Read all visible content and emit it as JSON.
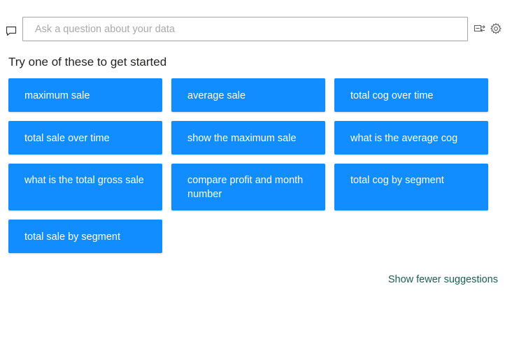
{
  "qa": {
    "search": {
      "placeholder": "Ask a question about your data",
      "value": ""
    },
    "heading": "Try one of these to get started",
    "suggestions": [
      "maximum sale",
      "average sale",
      "total cog over time",
      "total sale over time",
      "show the maximum sale",
      "what is the average cog",
      "what is the total gross sale",
      "compare profit and month number",
      "total cog by segment",
      "total sale by segment"
    ],
    "show_fewer_label": "Show fewer suggestions",
    "icons": {
      "chat": "chat-bubble-icon",
      "share": "convert-to-visual-icon",
      "settings": "gear-icon"
    },
    "colors": {
      "chip_background": "#118dff",
      "chip_text": "#ffffff",
      "link": "#1b5e52",
      "heading_text": "#252423",
      "input_border": "#a6a6a6"
    }
  }
}
